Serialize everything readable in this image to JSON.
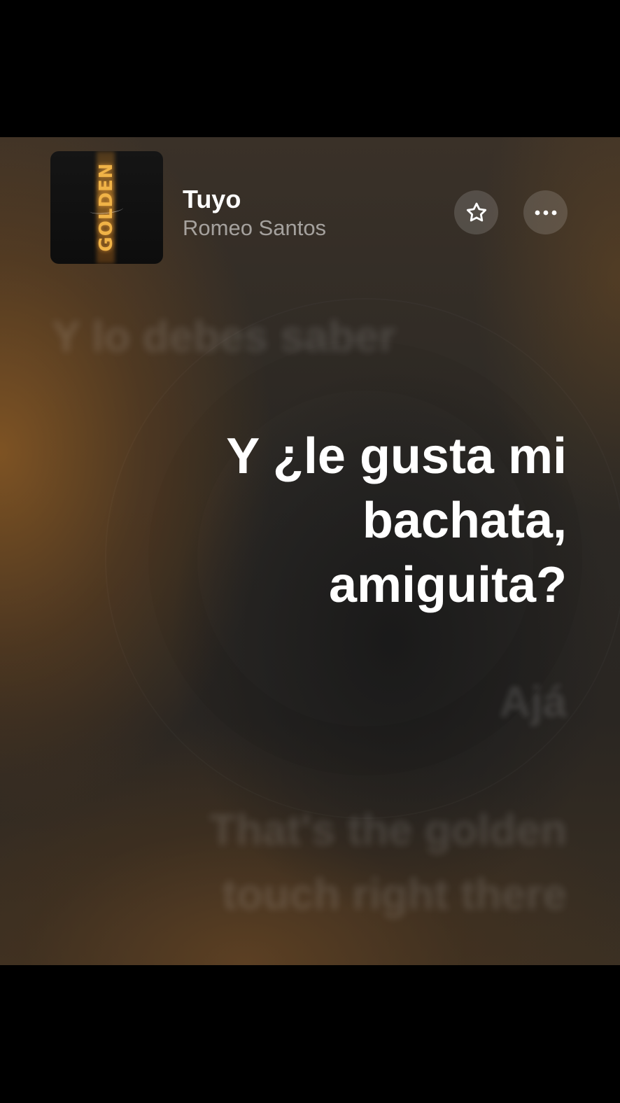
{
  "now_playing": {
    "album_art": {
      "text": "GOLDEN",
      "accent_color": "#f0b347"
    },
    "title": "Tuyo",
    "artist": "Romeo Santos",
    "favorite_icon": "star-outline-icon",
    "more_icon": "ellipsis-icon"
  },
  "lyrics": {
    "previous_line": "Y lo debes saber",
    "current_line": [
      "Y ¿le gusta mi",
      "bachata,",
      "amiguita?"
    ],
    "next_line": "Ajá",
    "following_line": [
      "That's the golden",
      "touch right there"
    ]
  }
}
